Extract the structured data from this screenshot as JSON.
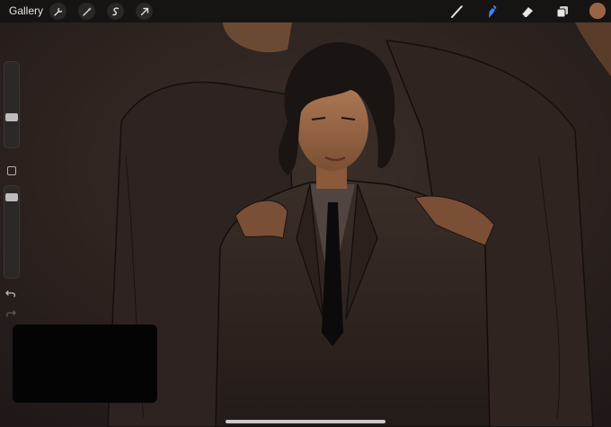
{
  "toolbar": {
    "gallery_label": "Gallery",
    "left_icons": [
      "wrench-icon",
      "magic-wand-icon",
      "selection-icon",
      "transform-arrow-icon"
    ],
    "right_tools": [
      "brush-icon",
      "smudge-icon",
      "eraser-icon",
      "layers-icon"
    ],
    "active_tool": "smudge-icon",
    "active_color": "#9a6443",
    "accent_color": "#3f83f6"
  },
  "sidebar": {
    "brush_size_level": 0.48,
    "opacity_level": 0.18,
    "icons": [
      "modify-square-icon",
      "undo-icon",
      "redo-icon"
    ]
  },
  "canvas": {
    "background_color": "#2a2220",
    "description_layer": "artwork"
  }
}
